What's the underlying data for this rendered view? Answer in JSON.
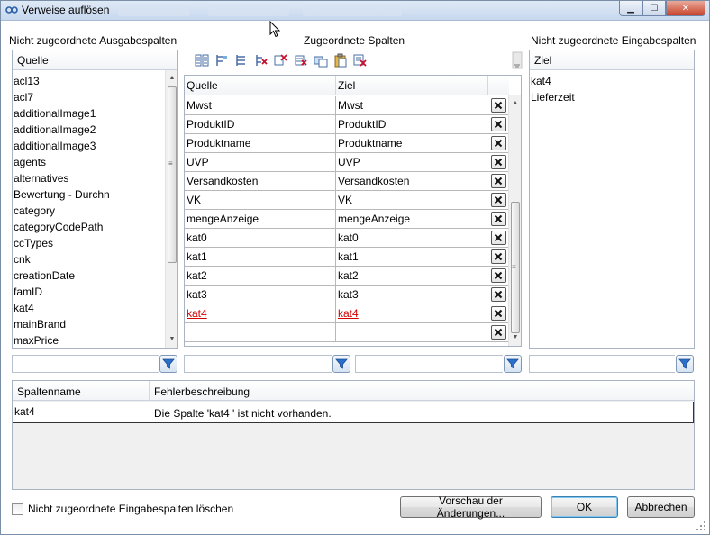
{
  "window": {
    "title": "Verweise auflösen",
    "controls": {
      "minimize": "▁",
      "maximize": "☐",
      "close": "✕"
    }
  },
  "left_panel": {
    "label": "Nicht zugeordnete Ausgabespalten",
    "header": "Quelle",
    "items": [
      "acl13",
      "acl7",
      "additionalImage1",
      "additionalImage2",
      "additionalImage3",
      "agents",
      "alternatives",
      "Bewertung - Durchn",
      "category",
      "categoryCodePath",
      "ccTypes",
      "cnk",
      "creationDate",
      "famID",
      "kat4",
      "mainBrand",
      "maxPrice"
    ]
  },
  "middle_panel": {
    "label": "Zugeordnete Spalten",
    "toolbar_icons": [
      "map-all-icon",
      "map-selected-icon",
      "map-by-name-icon",
      "remove-mapping-icon",
      "remove-all-icon",
      "delete-invalid-icon",
      "copy-icon",
      "paste-icon",
      "clear-icon"
    ],
    "columns": [
      "Quelle",
      "Ziel"
    ],
    "rows": [
      {
        "source": "Mwst",
        "target": "Mwst",
        "error": false
      },
      {
        "source": "ProduktID",
        "target": "ProduktID",
        "error": false
      },
      {
        "source": "Produktname",
        "target": "Produktname",
        "error": false
      },
      {
        "source": "UVP",
        "target": "UVP",
        "error": false
      },
      {
        "source": "Versandkosten",
        "target": "Versandkosten",
        "error": false
      },
      {
        "source": "VK",
        "target": "VK",
        "error": false
      },
      {
        "source": "mengeAnzeige",
        "target": "mengeAnzeige",
        "error": false
      },
      {
        "source": "kat0",
        "target": "kat0",
        "error": false
      },
      {
        "source": "kat1",
        "target": "kat1",
        "error": false
      },
      {
        "source": "kat2",
        "target": "kat2",
        "error": false
      },
      {
        "source": "kat3",
        "target": "kat3",
        "error": false
      },
      {
        "source": "kat4",
        "target": "kat4",
        "error": true
      },
      {
        "source": "",
        "target": "",
        "error": false
      }
    ]
  },
  "right_panel": {
    "label": "Nicht zugeordnete Eingabespalten",
    "header": "Ziel",
    "items": [
      "kat4",
      "Lieferzeit"
    ]
  },
  "error_list": {
    "columns": [
      "Spaltenname",
      "Fehlerbeschreibung"
    ],
    "rows": [
      {
        "column": "kat4",
        "description": "Die Spalte 'kat4 ' ist nicht vorhanden."
      }
    ]
  },
  "footer": {
    "checkbox_label": "Nicht zugeordnete Eingabespalten löschen",
    "checkbox_checked": false,
    "preview_button": "Vorschau der Änderungen...",
    "ok_button": "OK",
    "cancel_button": "Abbrechen"
  },
  "colors": {
    "error": "#d40000",
    "accent": "#3c7fb1",
    "filter": "#2a6fc9"
  }
}
